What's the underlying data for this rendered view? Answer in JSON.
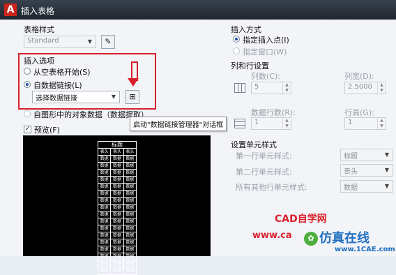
{
  "window": {
    "title": "插入表格"
  },
  "table_style": {
    "label": "表格样式",
    "value": "Standard",
    "button_icon": "table-style-dialog-icon"
  },
  "insert_options": {
    "label": "插入选项",
    "from_empty": "从空表格开始(S)",
    "from_data_link": "自数据链接(L)",
    "data_link_select": "选择数据链接",
    "from_drawing": "自图形中的对象数据（数据提取）(X)",
    "launch_btn_icon": "data-link-manager-icon"
  },
  "tooltip": "启动\"数据链接管理器\"对话框",
  "preview": {
    "label": "预览(F)",
    "checked": true,
    "table_title": "标题",
    "header_cells": [
      "表头",
      "表头",
      "表头"
    ],
    "data_cell": "数据",
    "data_rows": 17
  },
  "insert_method": {
    "label": "插入方式",
    "specify_point": "指定插入点(I)",
    "specify_window": "指定窗口(W)"
  },
  "columns_rows": {
    "label": "列和行设置",
    "columns_label": "列数(C):",
    "columns_value": "5",
    "col_width_label": "列宽(D):",
    "col_width_value": "2.5000",
    "data_rows_label": "数据行数(R):",
    "data_rows_value": "1",
    "row_height_label": "行高(G):",
    "row_height_value": "1"
  },
  "cell_styles": {
    "label": "设置单元样式",
    "first_row_label": "第一行单元样式:",
    "first_row_value": "标题",
    "second_row_label": "第二行单元样式:",
    "second_row_value": "表头",
    "other_rows_label": "所有其他行单元样式:",
    "other_rows_value": "数据"
  },
  "watermark": {
    "site_name": "CAD自学网",
    "url_part": "www.ca",
    "brand": "仿真在线",
    "brand_url": "www.1CAE.com"
  },
  "colors": {
    "highlight": "#d9202a",
    "titlebar": "#2a323c"
  }
}
